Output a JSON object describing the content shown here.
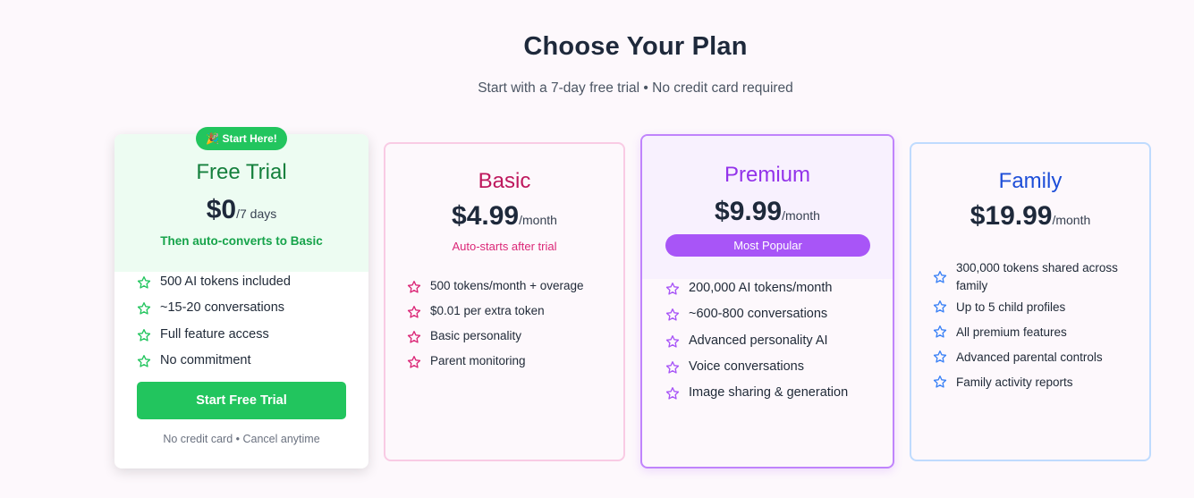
{
  "header": {
    "title": "Choose Your Plan",
    "subtitle": "Start with a 7-day free trial • No credit card required"
  },
  "colors": {
    "green": "#22c55e",
    "pink": "#db2777",
    "purple": "#a855f7",
    "blue": "#3b82f6"
  },
  "plans": {
    "free": {
      "badge": "🎉 Start Here!",
      "name": "Free Trial",
      "price": "$0",
      "period": "/7 days",
      "note": "Then auto-converts to Basic",
      "features": [
        "500 AI tokens included",
        "~15-20 conversations",
        "Full feature access",
        "No commitment"
      ],
      "cta": "Start Free Trial",
      "fine_print": "No credit card • Cancel anytime",
      "icon": "star-icon"
    },
    "basic": {
      "name": "Basic",
      "price": "$4.99",
      "period": "/month",
      "note": "Auto-starts after trial",
      "features": [
        "500 tokens/month + overage",
        "$0.01 per extra token",
        "Basic personality",
        "Parent monitoring"
      ],
      "icon": "star-icon"
    },
    "premium": {
      "name": "Premium",
      "price": "$9.99",
      "period": "/month",
      "tag": "Most Popular",
      "features": [
        "200,000 AI tokens/month",
        "~600-800 conversations",
        "Advanced personality AI",
        "Voice conversations",
        "Image sharing & generation"
      ],
      "icon": "star-icon"
    },
    "family": {
      "name": "Family",
      "price": "$19.99",
      "period": "/month",
      "features": [
        "300,000 tokens shared across family",
        "Up to 5 child profiles",
        "All premium features",
        "Advanced parental controls",
        "Family activity reports"
      ],
      "icon": "star-icon"
    }
  }
}
